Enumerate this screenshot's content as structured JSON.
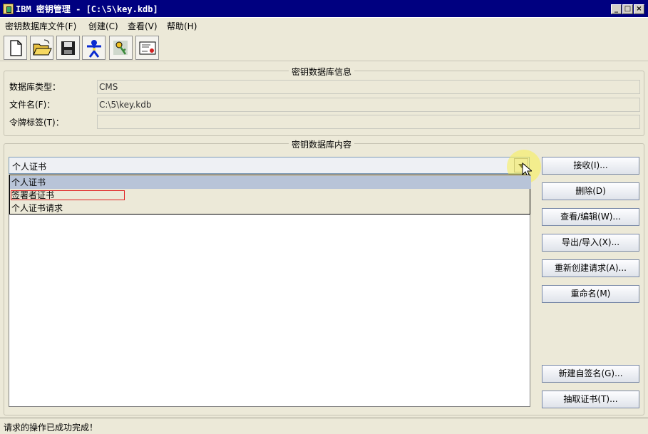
{
  "window": {
    "title": "IBM 密钥管理 - [C:\\5\\key.kdb]",
    "controls": [
      "_",
      "□",
      "×"
    ]
  },
  "menu": [
    "密钥数据库文件(F)",
    "创建(C)",
    "查看(V)",
    "帮助(H)"
  ],
  "toolbar": [
    "new-file-icon",
    "open-folder-icon",
    "save-disk-icon",
    "person-key-icon",
    "key-lock-icon",
    "certificate-icon"
  ],
  "db_info": {
    "section_title": "密钥数据库信息",
    "type_label": "数据库类型：",
    "type_value": "CMS",
    "file_label": "文件名(F)：",
    "file_value": "C:\\5\\key.kdb",
    "token_label": "令牌标签(T)：",
    "token_value": ""
  },
  "db_content": {
    "section_title": "密钥数据库内容",
    "combo_value": "个人证书",
    "options": [
      "个人证书",
      "签署者证书",
      "个人证书请求"
    ]
  },
  "actions": {
    "receive": "接收(I)...",
    "delete": "删除(D)",
    "view_edit": "查看/编辑(W)...",
    "export_import": "导出/导入(X)...",
    "recreate_request": "重新创建请求(A)...",
    "rename": "重命名(M)",
    "new_self_signed": "新建自签名(G)...",
    "extract_cert": "抽取证书(T)..."
  },
  "status": "请求的操作已成功完成！",
  "colors": {
    "titlebar": "#000080",
    "selection": "#b8c4d8",
    "highlight_outline": "#e02020"
  }
}
